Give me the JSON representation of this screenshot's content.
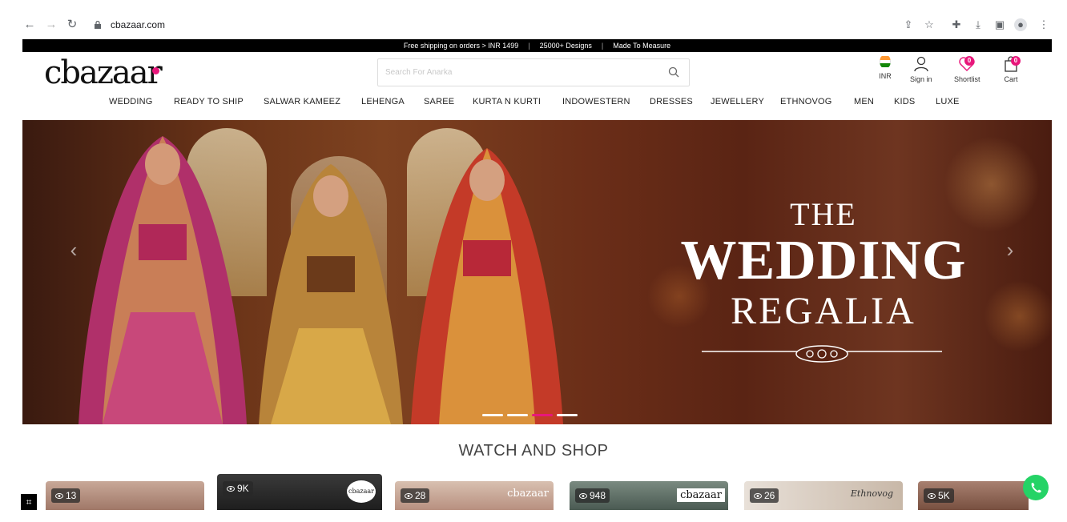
{
  "browser": {
    "url": "cbazaar.com"
  },
  "promo": {
    "items": [
      "Free shipping on orders > INR 1499",
      "25000+ Designs",
      "Made To Measure"
    ],
    "separator": "|"
  },
  "header": {
    "logo_text": "cbazaar",
    "search_placeholder": "Search For Anarka",
    "currency_label": "INR",
    "sign_in_label": "Sign in",
    "shortlist_label": "Shortlist",
    "shortlist_count": "0",
    "cart_label": "Cart",
    "cart_count": "0"
  },
  "categories": [
    "WEDDING",
    "READY TO SHIP",
    "SALWAR KAMEEZ",
    "LEHENGA",
    "SAREE",
    "KURTA N KURTI",
    "INDOWESTERN",
    "DRESSES",
    "JEWELLERY",
    "ETHNOVOG",
    "MEN",
    "KIDS",
    "LUXE"
  ],
  "hero": {
    "line1": "THE",
    "line2": "WEDDING",
    "line3": "REGALIA",
    "slides": 4,
    "active_slide": 3
  },
  "watch_and_shop": {
    "title": "WATCH AND SHOP",
    "cards": [
      {
        "views": "13",
        "logo": ""
      },
      {
        "views": "9K",
        "logo": "cbazaar"
      },
      {
        "views": "28",
        "logo": "cbazaar"
      },
      {
        "views": "948",
        "logo": "cbazaar"
      },
      {
        "views": "26",
        "logo": "Ethnovog"
      },
      {
        "views": "5K",
        "logo": ""
      }
    ]
  },
  "colors": {
    "brand_pink": "#e8177b",
    "promo_bg": "#000000",
    "whatsapp_green": "#25d366"
  }
}
